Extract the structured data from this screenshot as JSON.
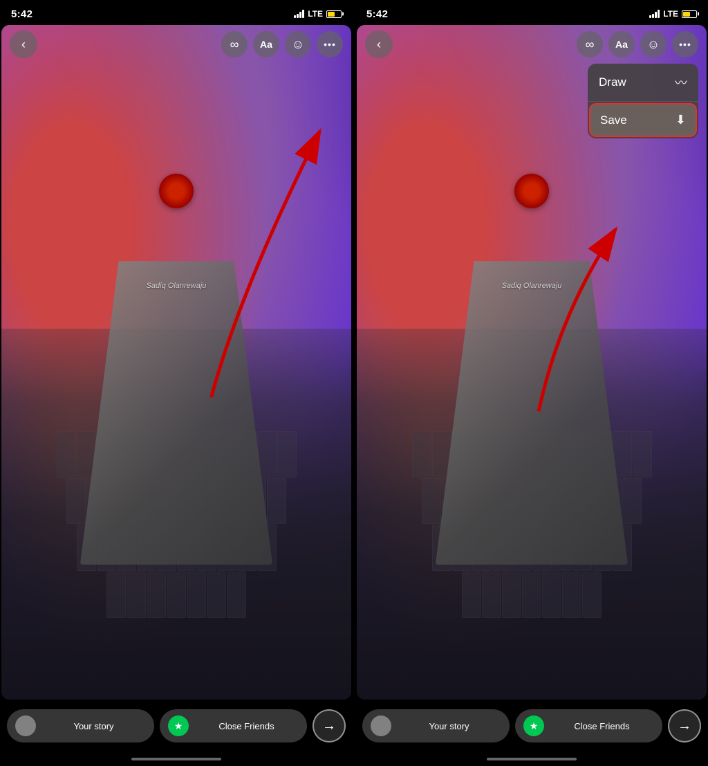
{
  "screens": [
    {
      "id": "screen-left",
      "status": {
        "time": "5:42",
        "lte": "LTE"
      },
      "controls": {
        "back_label": "‹",
        "infinity_label": "∞",
        "text_label": "Aa",
        "sticker_label": "☺",
        "more_label": "•••"
      },
      "watermark": "Sadiq Olanrewaju",
      "bottom": {
        "your_story_label": "Your story",
        "close_friends_label": "Close Friends",
        "send_icon": "→"
      },
      "has_dropdown": false,
      "has_arrow": true
    },
    {
      "id": "screen-right",
      "status": {
        "time": "5:42",
        "lte": "LTE"
      },
      "controls": {
        "back_label": "‹",
        "infinity_label": "∞",
        "text_label": "Aa",
        "sticker_label": "☺",
        "more_label": "•••"
      },
      "watermark": "Sadiq Olanrewaju",
      "dropdown": {
        "draw_label": "Draw",
        "draw_icon": "〰",
        "save_label": "Save",
        "save_icon": "⬇"
      },
      "bottom": {
        "your_story_label": "Your story",
        "close_friends_label": "Close Friends",
        "send_icon": "→"
      },
      "has_dropdown": true,
      "has_arrow": true
    }
  ],
  "colors": {
    "bg": "#000000",
    "control_bg": "rgba(100,100,100,0.7)",
    "dropdown_bg": "rgba(70,65,70,0.95)",
    "save_highlight": "#e63030",
    "green": "#00c853",
    "red_arrow": "#cc0000"
  }
}
